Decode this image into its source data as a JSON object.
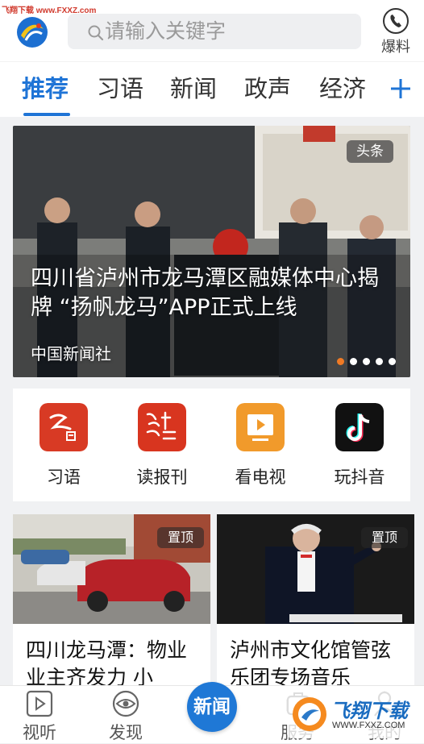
{
  "watermark": "飞翔下载 www.FXXZ.com",
  "header": {
    "search_placeholder": "请输入关键字",
    "baoliao_label": "爆料"
  },
  "tabs": [
    {
      "label": "推荐",
      "active": true
    },
    {
      "label": "习语",
      "active": false
    },
    {
      "label": "新闻",
      "active": false
    },
    {
      "label": "政声",
      "active": false
    },
    {
      "label": "经济",
      "active": false
    }
  ],
  "hero": {
    "tag": "头条",
    "title": "四川省泸州市龙马潭区融媒体中心揭牌 “扬帆龙马”APP正式上线",
    "source": "中国新闻社",
    "carousel": {
      "count": 5,
      "active_index": 0
    }
  },
  "services": [
    {
      "label": "习语",
      "icon": "xiyu-icon",
      "color": "#d83a24"
    },
    {
      "label": "读报刊",
      "icon": "newspaper-icon",
      "color": "#d8351f"
    },
    {
      "label": "看电视",
      "icon": "tv-icon",
      "color": "#f19a2b"
    },
    {
      "label": "玩抖音",
      "icon": "douyin-icon",
      "color": "#111111"
    }
  ],
  "news_cards": [
    {
      "badge": "置顶",
      "title": "四川龙马潭：物业业主齐发力 小"
    },
    {
      "badge": "置顶",
      "title": "泸州市文化馆管弦乐团专场音乐"
    }
  ],
  "bottom_nav": [
    {
      "label": "视听",
      "icon": "play-icon"
    },
    {
      "label": "发现",
      "icon": "eye-icon"
    },
    {
      "label": "新闻",
      "icon": "news-icon",
      "center": true
    },
    {
      "label": "服务",
      "icon": "service-icon"
    },
    {
      "label": "我的",
      "icon": "user-icon"
    }
  ],
  "overlay_logo": {
    "text": "飞翔下载",
    "url_text": "WWW.FXXZ.COM"
  },
  "colors": {
    "accent": "#1f74d6",
    "orange_dot": "#f07a24"
  }
}
